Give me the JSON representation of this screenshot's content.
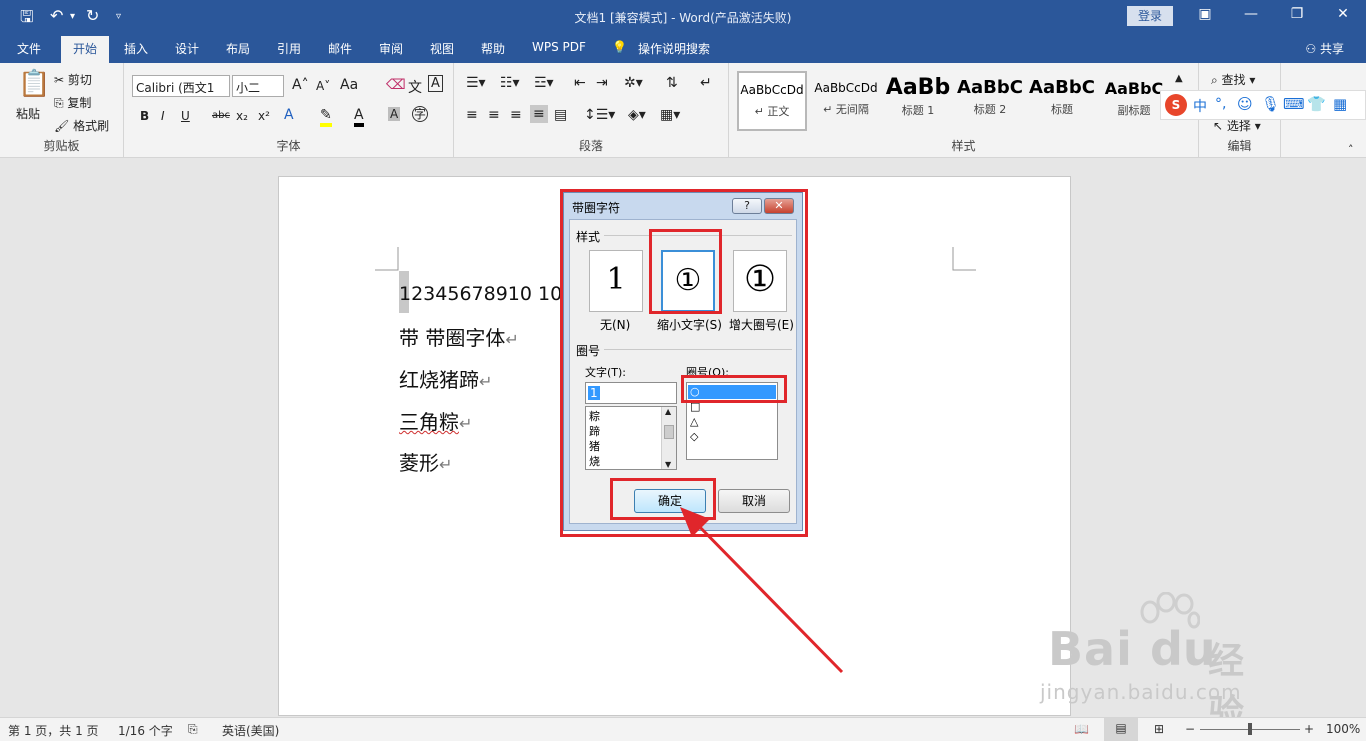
{
  "titlebar": {
    "title": "文档1 [兼容模式] - Word(产品激活失败)",
    "login": "登录"
  },
  "tabs": [
    "文件",
    "开始",
    "插入",
    "设计",
    "布局",
    "引用",
    "邮件",
    "审阅",
    "视图",
    "帮助",
    "WPS PDF",
    "操作说明搜索"
  ],
  "share": "共享",
  "clipboard": {
    "paste": "粘贴",
    "cut": "剪切",
    "copy": "复制",
    "format_painter": "格式刷",
    "label": "剪贴板"
  },
  "font": {
    "family": "Calibri (西文1",
    "size": "小二",
    "label": "字体",
    "aa": "Aa",
    "bold": "B",
    "italic": "I",
    "underline": "U",
    "strike": "abc",
    "sub": "x₂",
    "sup": "x²",
    "wen": "文",
    "a_box": "A",
    "zi": "字"
  },
  "paragraph": {
    "label": "段落"
  },
  "styles": {
    "label": "样式",
    "items": [
      {
        "preview": "AaBbCcDd",
        "name": "↵ 正文"
      },
      {
        "preview": "AaBbCcDd",
        "name": "↵ 无间隔"
      },
      {
        "preview": "AaBb",
        "name": "标题 1"
      },
      {
        "preview": "AaBbC",
        "name": "标题 2"
      },
      {
        "preview": "AaBbC",
        "name": "标题"
      },
      {
        "preview": "AaBbC",
        "name": "副标题"
      }
    ]
  },
  "editing": {
    "find": "查找",
    "select": "选择",
    "label": "编辑"
  },
  "ime": {
    "zh": "中"
  },
  "document": {
    "lines": [
      "12345678910 10",
      "带  带圈字体",
      "红烧猪蹄",
      "三角粽",
      "菱形"
    ]
  },
  "dialog": {
    "title": "带圈字符",
    "help": "?",
    "close": "✕",
    "style_section": "样式",
    "options": [
      {
        "glyph": "1",
        "label": "无(N)"
      },
      {
        "glyph": "①",
        "label": "缩小文字(S)"
      },
      {
        "glyph": "①",
        "label": "增大圈号(E)"
      }
    ],
    "circle_section": "圈号",
    "text_label": "文字(T):",
    "text_value": "1",
    "text_list": [
      "粽",
      "蹄",
      "猪",
      "烧"
    ],
    "circle_label": "圈号(O):",
    "circle_list": [
      "○",
      "□",
      "△",
      "◇"
    ],
    "ok": "确定",
    "cancel": "取消"
  },
  "status": {
    "page": "第 1 页，共 1 页",
    "words": "1/16 个字",
    "lang": "英语(美国)",
    "zoom": "100%",
    "minus": "−",
    "plus": "+"
  },
  "watermark": {
    "brand": "Bai",
    "du": "du",
    "jy": "经验",
    "url": "jingyan.baidu.com"
  }
}
